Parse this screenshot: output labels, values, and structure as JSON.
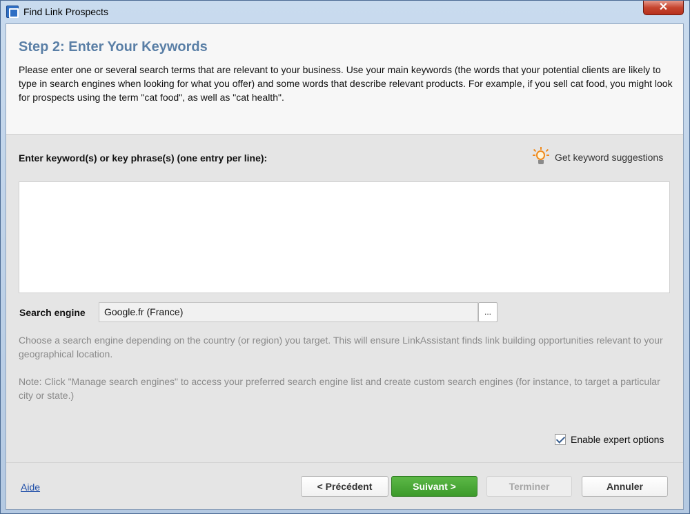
{
  "window": {
    "title": "Find Link Prospects",
    "close_glyph": "✕"
  },
  "header": {
    "step_title": "Step 2: Enter Your Keywords",
    "description": "Please enter one or several search terms that are relevant to your business. Use your main keywords (the words that your potential clients are likely to type in search engines when looking for what you offer) and some words that describe relevant products. For example, if you sell cat food, you might look for prospects using the term \"cat food\", as well as \"cat health\"."
  },
  "keywords": {
    "label": "Enter keyword(s) or key phrase(s) (one entry per line):",
    "suggestions_link": "Get keyword suggestions",
    "suggestions_icon": "lightbulb-icon",
    "value": ""
  },
  "search_engine": {
    "label": "Search engine",
    "value": "Google.fr (France)",
    "browse_label": "...",
    "hint": "Choose a search engine depending on the country (or region) you target. This will ensure LinkAssistant finds link building opportunities relevant to your geographical location.",
    "note": "Note: Click \"Manage search engines\" to access your preferred search engine list and create custom search engines (for instance, to target a particular city or state.)"
  },
  "expert_options": {
    "label": "Enable expert options",
    "checked": true
  },
  "footer": {
    "help_link": "Aide",
    "prev_label": "< Précédent",
    "next_label": "Suivant >",
    "finish_label": "Terminer",
    "cancel_label": "Annuler"
  },
  "colors": {
    "step_title": "#5a7fa6",
    "next_button": "#4aaa37",
    "help_link": "#1f4ea8"
  }
}
